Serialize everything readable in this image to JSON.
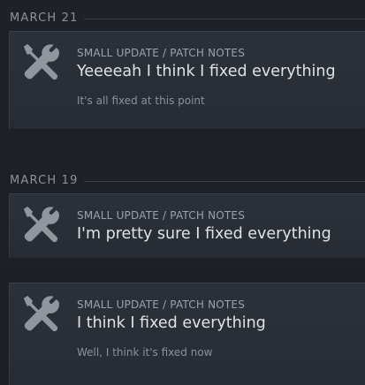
{
  "sections": [
    {
      "date": "MARCH 21",
      "events": [
        {
          "category": "SMALL UPDATE / PATCH NOTES",
          "icon": "tools-icon",
          "title": "Yeeeeah I think I fixed everything",
          "subtitle": "It's all fixed at this point"
        }
      ]
    },
    {
      "date": "MARCH 19",
      "events": [
        {
          "category": "SMALL UPDATE / PATCH NOTES",
          "icon": "tools-icon",
          "title": "I'm pretty sure I fixed everything",
          "subtitle": ""
        },
        {
          "category": "SMALL UPDATE / PATCH NOTES",
          "icon": "tools-icon",
          "title": "I think I fixed everything",
          "subtitle": "Well, I think it's fixed now"
        }
      ]
    }
  ],
  "colors": {
    "background": "#1e2228",
    "card": "#2b313a",
    "date_text": "#8b929a",
    "title_text": "#dfe3e6",
    "icon": "#8f969d"
  }
}
